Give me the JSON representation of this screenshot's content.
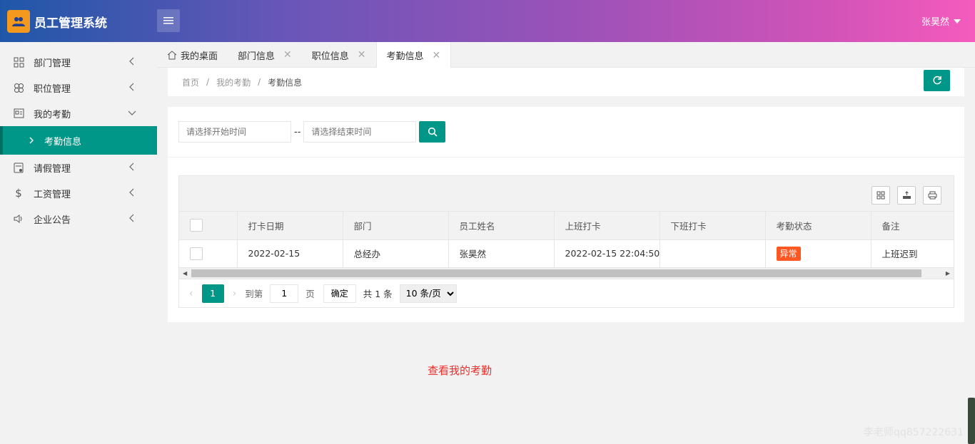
{
  "app": {
    "title": "员工管理系统",
    "user": "张昊然"
  },
  "sidebar": {
    "items": [
      {
        "label": "部门管理",
        "icon": "grid-icon"
      },
      {
        "label": "职位管理",
        "icon": "clover-icon"
      },
      {
        "label": "我的考勤",
        "icon": "calendar-card-icon"
      },
      {
        "label": "请假管理",
        "icon": "form-icon"
      },
      {
        "label": "工资管理",
        "icon": "dollar-icon"
      },
      {
        "label": "企业公告",
        "icon": "speaker-icon"
      }
    ],
    "active_sub": "考勤信息"
  },
  "tabs": [
    {
      "label": "我的桌面"
    },
    {
      "label": "部门信息"
    },
    {
      "label": "职位信息"
    },
    {
      "label": "考勤信息"
    }
  ],
  "breadcrumb": [
    "首页",
    "我的考勤",
    "考勤信息"
  ],
  "search": {
    "start_placeholder": "请选择开始时间",
    "end_placeholder": "请选择结束时间",
    "separator": "--"
  },
  "table": {
    "columns": [
      "打卡日期",
      "部门",
      "员工姓名",
      "上班打卡",
      "下班打卡",
      "考勤状态",
      "备注"
    ],
    "rows": [
      {
        "date": "2022-02-15",
        "dept": "总经办",
        "name": "张昊然",
        "clock_in": "2022-02-15 22:04:50",
        "clock_out": "",
        "status": "异常",
        "remark": "上班迟到"
      }
    ]
  },
  "pager": {
    "current": "1",
    "goto_label": "到第",
    "goto_value": "1",
    "page_label": "页",
    "confirm": "确定",
    "total": "共 1 条",
    "page_size": "10 条/页"
  },
  "note": "查看我的考勤",
  "watermark": "李老师qq857222631",
  "colors": {
    "accent": "#009688",
    "danger": "#ff5722",
    "note": "#e8312d"
  }
}
